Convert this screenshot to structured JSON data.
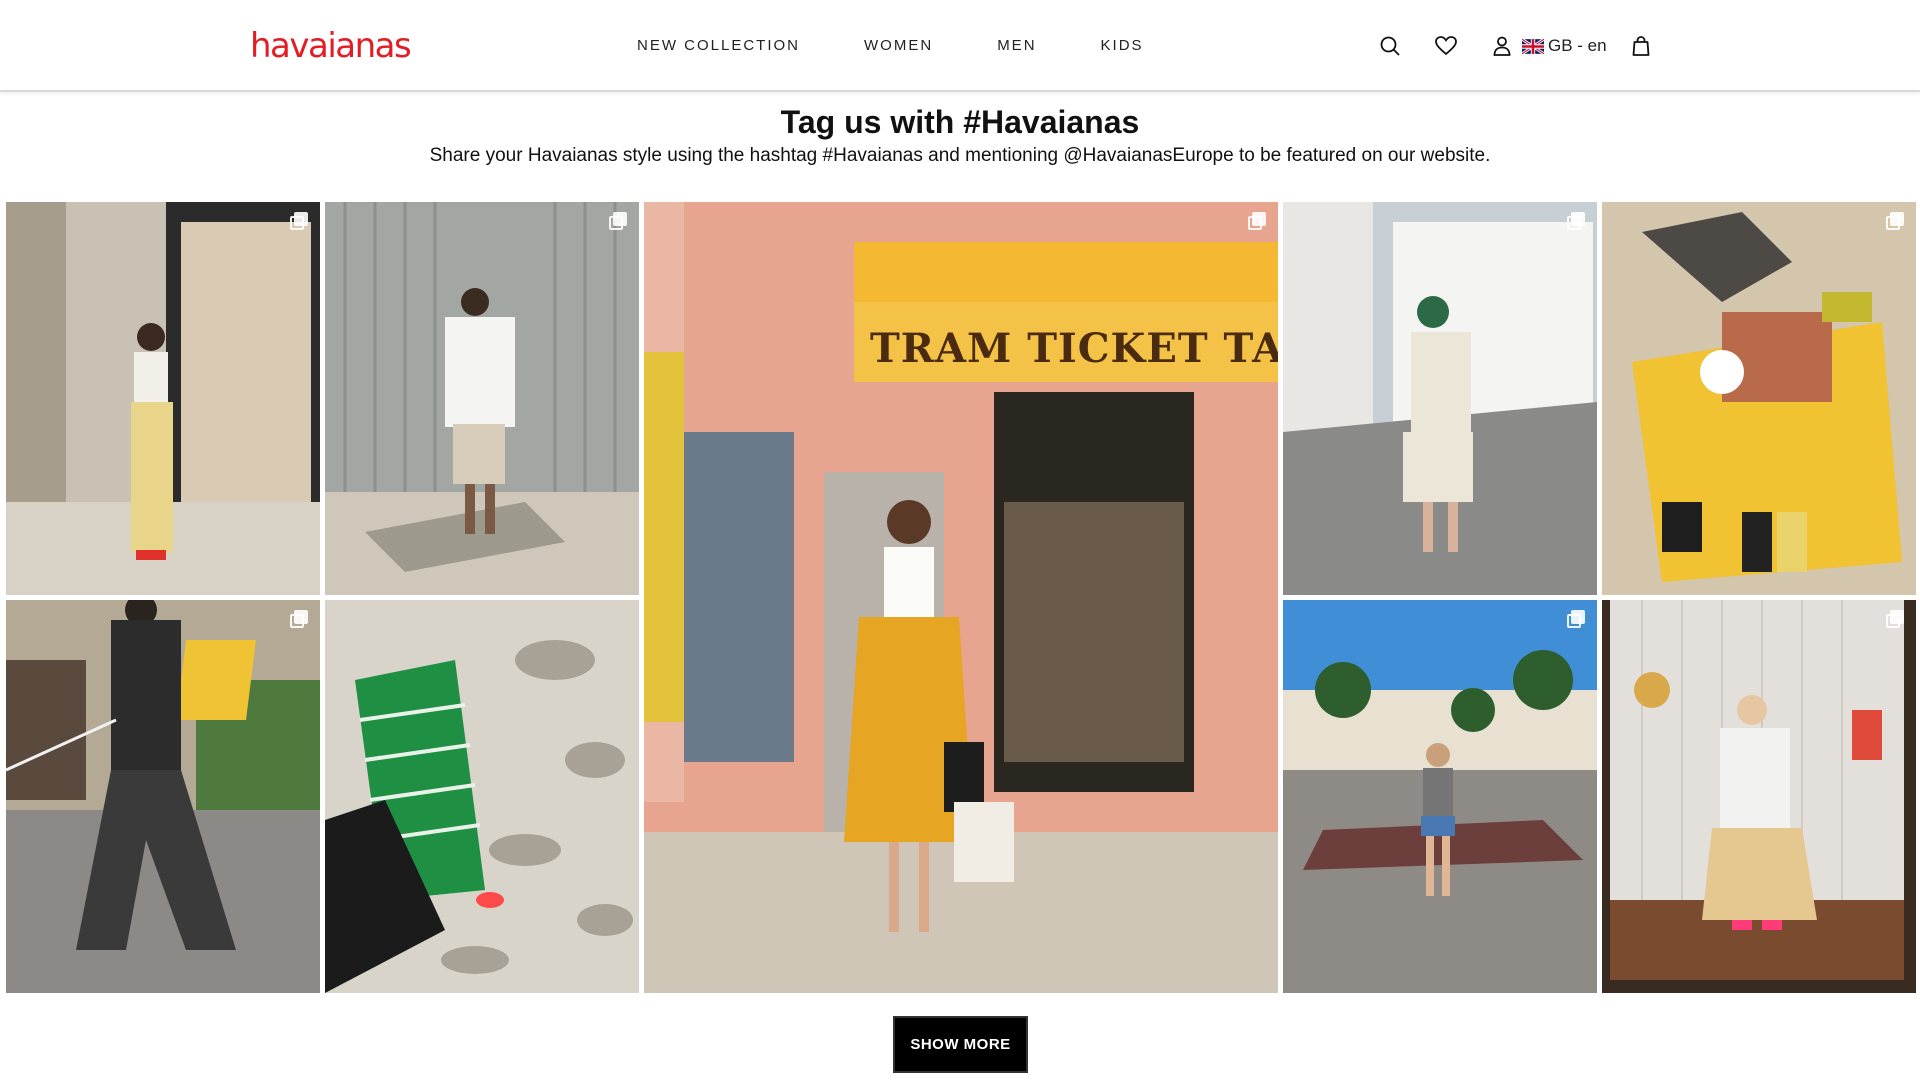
{
  "header": {
    "logo_text": "havaianas",
    "brand_color": "#e31d25",
    "nav": [
      "NEW COLLECTION",
      "WOMEN",
      "MEN",
      "KIDS"
    ],
    "icons": [
      "search-icon",
      "heart-icon",
      "user-icon",
      "flag-uk-icon",
      "bag-icon"
    ],
    "locale": "GB - en"
  },
  "intro": {
    "title": "Tag us with #Havaianas",
    "subtitle": "Share your Havaianas style using the hashtag #Havaianas and mentioning @HavaianasEurope to be featured on our website."
  },
  "gallery": {
    "featured_sign": "TRAM TICKET   TABA",
    "tiles": [
      {
        "subject": "woman in plaid trousers in doorway",
        "multi": true
      },
      {
        "subject": "man in white shirt by metal shutter",
        "multi": true
      },
      {
        "subject": "woman in yellow skirt at tram ticket kiosk",
        "multi": true
      },
      {
        "subject": "woman holding baby on cobbled street",
        "multi": true
      },
      {
        "subject": "person lying on yellow towel at beach",
        "multi": true
      },
      {
        "subject": "man in dark jumpsuit walking",
        "multi": true
      },
      {
        "subject": "woman in green striped top on cobblestones",
        "multi": false
      },
      {
        "subject": "woman walking on palm-lined street",
        "multi": true
      },
      {
        "subject": "mirror selfie in white t-shirt",
        "multi": true
      }
    ]
  },
  "actions": {
    "show_more": "SHOW MORE"
  }
}
